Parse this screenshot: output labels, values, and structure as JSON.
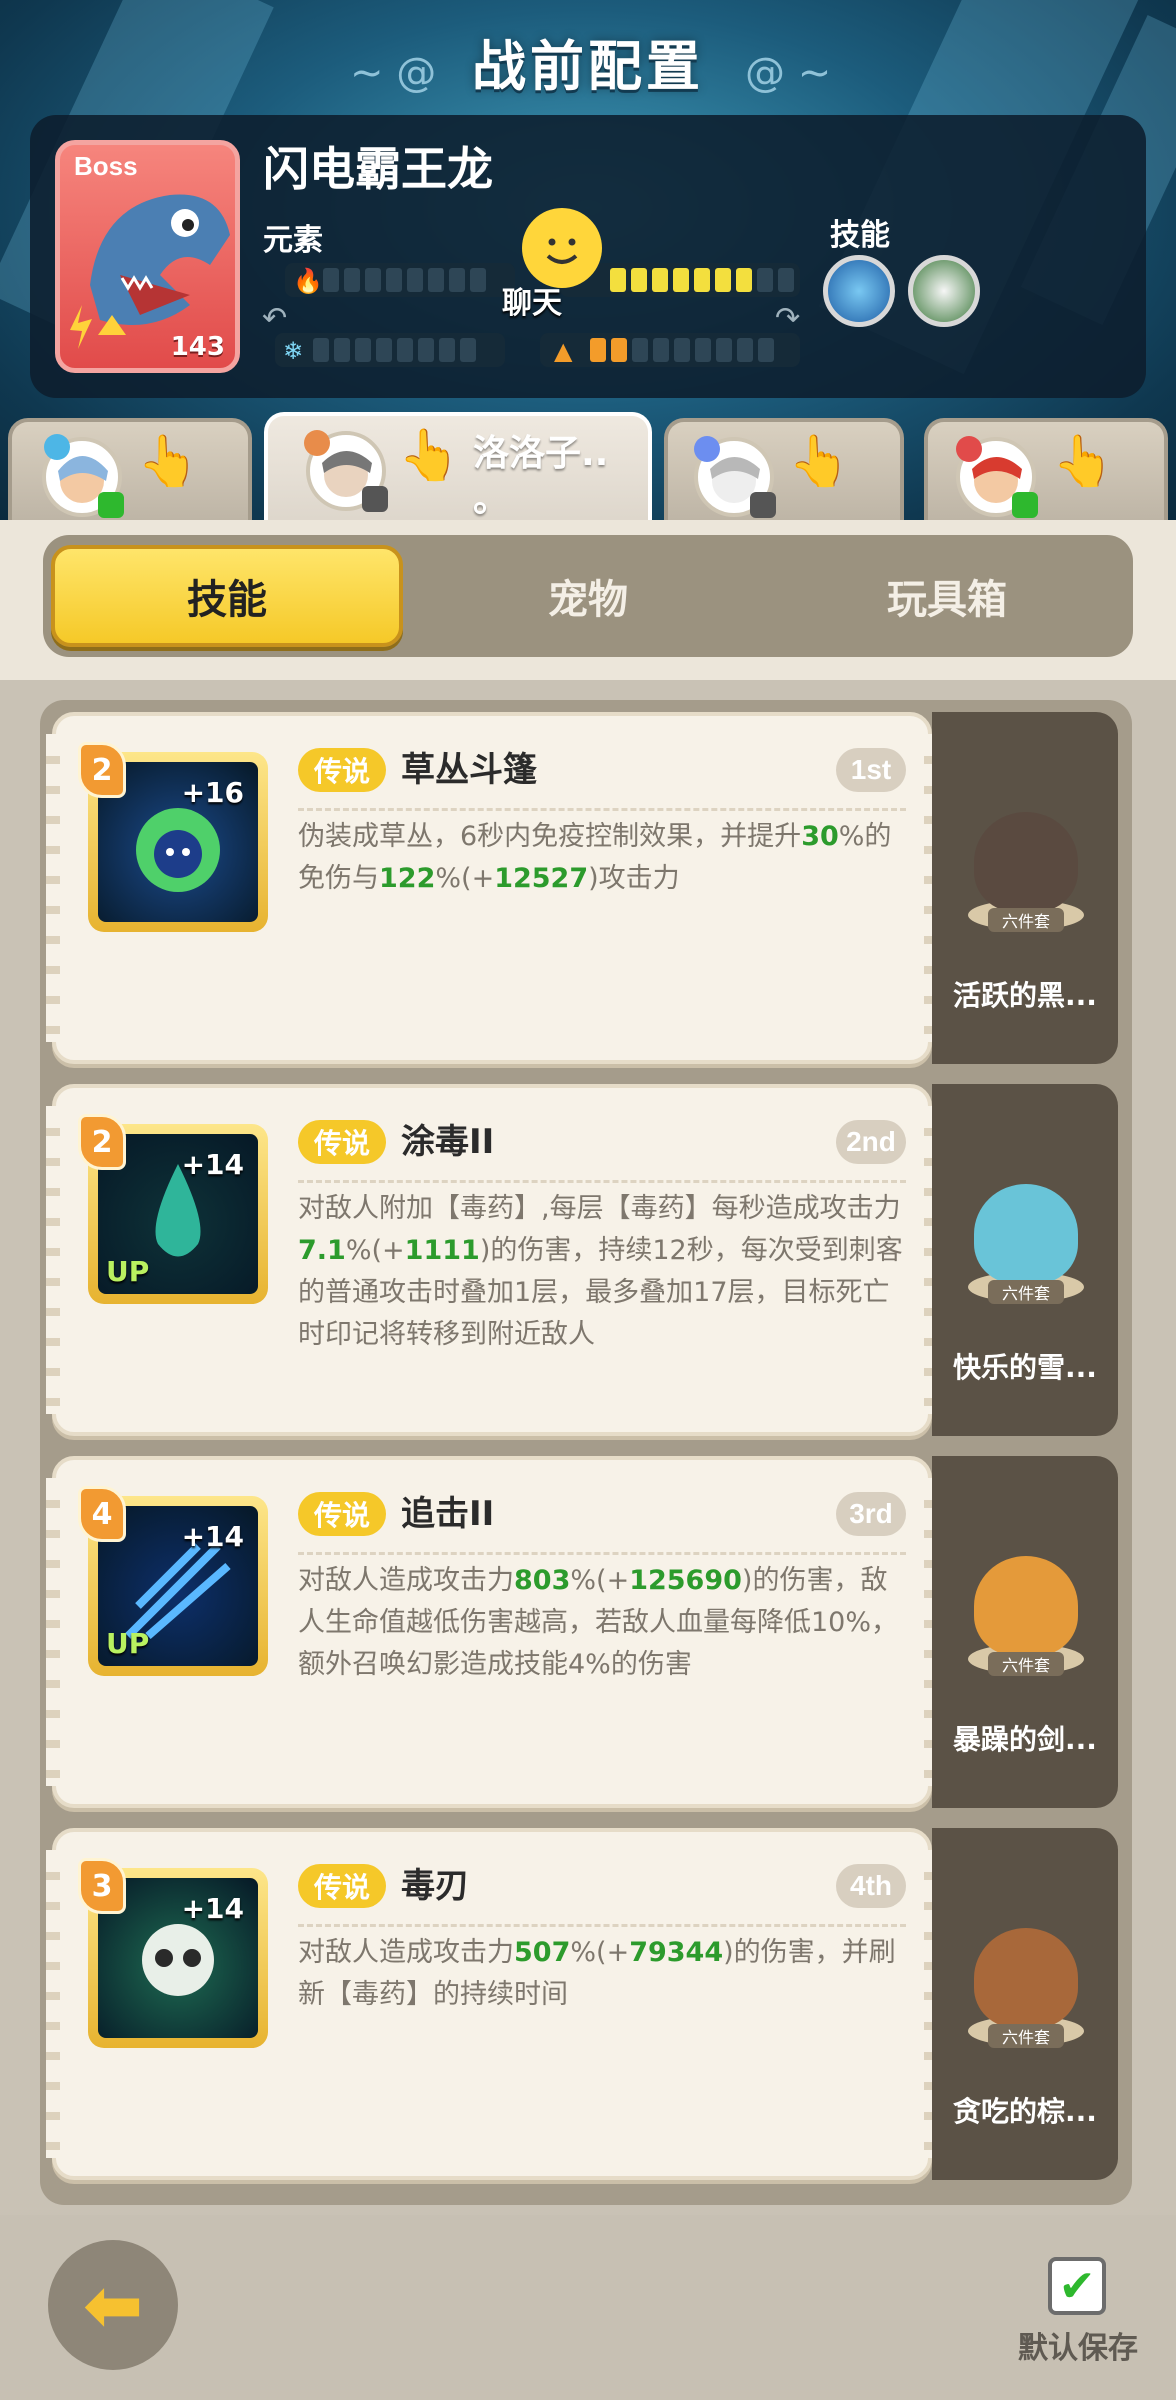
{
  "header": {
    "title": "战前配置",
    "boss": {
      "tag": "Boss",
      "name": "闪电霸王龙",
      "level": "143",
      "element_label": "元素",
      "skill_label": "技能",
      "chat_label": "聊天"
    }
  },
  "players": [
    {
      "name": "",
      "badge_color": "#4db6e6",
      "active": false
    },
    {
      "name": "洛洛子..\n。",
      "badge_color": "#e88c4a",
      "active": true
    },
    {
      "name": "",
      "badge_color": "#6c8ef0",
      "active": false
    },
    {
      "name": "",
      "badge_color": "#e14b4a",
      "active": false
    }
  ],
  "tabs": [
    "技能",
    "宠物",
    "玩具箱"
  ],
  "skills": [
    {
      "level": "2",
      "plus": "+16",
      "up": "",
      "rarity": "传说",
      "name": "草丛斗篷",
      "rank": "1st",
      "desc_parts": [
        {
          "t": "伪装成草丛，6秒内免疫控制效果，并提升"
        },
        {
          "t": "30",
          "g": true
        },
        {
          "t": "%的免伤与"
        },
        {
          "t": "122",
          "g": true
        },
        {
          "t": "%(+"
        },
        {
          "t": "12527",
          "g": true
        },
        {
          "t": ")攻击力"
        }
      ],
      "icon_color": "#1b4a8c",
      "pet_name": "活跃的黑...",
      "pet_set": "六件套",
      "pet_color": "#5a4a40"
    },
    {
      "level": "2",
      "plus": "+14",
      "up": "UP",
      "rarity": "传说",
      "name": "涂毒II",
      "rank": "2nd",
      "desc_parts": [
        {
          "t": "对敌人附加【毒药】,每层【毒药】每秒造成攻击力"
        },
        {
          "t": "7.1",
          "g": true
        },
        {
          "t": "%(+"
        },
        {
          "t": "1111",
          "g": true
        },
        {
          "t": ")的伤害，持续12秒，每次受到刺客的普通攻击时叠加1层，最多叠加17层，目标死亡时印记将转移到附近敌人"
        }
      ],
      "icon_color": "#0e3238",
      "pet_name": "快乐的雪...",
      "pet_set": "六件套",
      "pet_color": "#69c4d8"
    },
    {
      "level": "4",
      "plus": "+14",
      "up": "UP",
      "rarity": "传说",
      "name": "追击II",
      "rank": "3rd",
      "desc_parts": [
        {
          "t": "对敌人造成攻击力"
        },
        {
          "t": "803",
          "g": true
        },
        {
          "t": "%(+"
        },
        {
          "t": "125690",
          "g": true
        },
        {
          "t": ")的伤害，敌人生命值越低伤害越高，若敌人血量每降低10%，额外召唤幻影造成技能4%的伤害"
        }
      ],
      "icon_color": "#0d2f6a",
      "pet_name": "暴躁的剑...",
      "pet_set": "六件套",
      "pet_color": "#e49a3a"
    },
    {
      "level": "3",
      "plus": "+14",
      "up": "",
      "rarity": "传说",
      "name": "毒刃",
      "rank": "4th",
      "desc_parts": [
        {
          "t": "对敌人造成攻击力"
        },
        {
          "t": "507",
          "g": true
        },
        {
          "t": "%(+"
        },
        {
          "t": "79344",
          "g": true
        },
        {
          "t": ")的伤害，并刷新【毒药】的持续时间"
        }
      ],
      "icon_color": "#1e6b52",
      "pet_name": "贪吃的棕...",
      "pet_set": "六件套",
      "pet_color": "#a8683a"
    }
  ],
  "footer": {
    "back_icon": "arrow-left-icon",
    "save_label": "默认保存",
    "save_checked": true
  }
}
